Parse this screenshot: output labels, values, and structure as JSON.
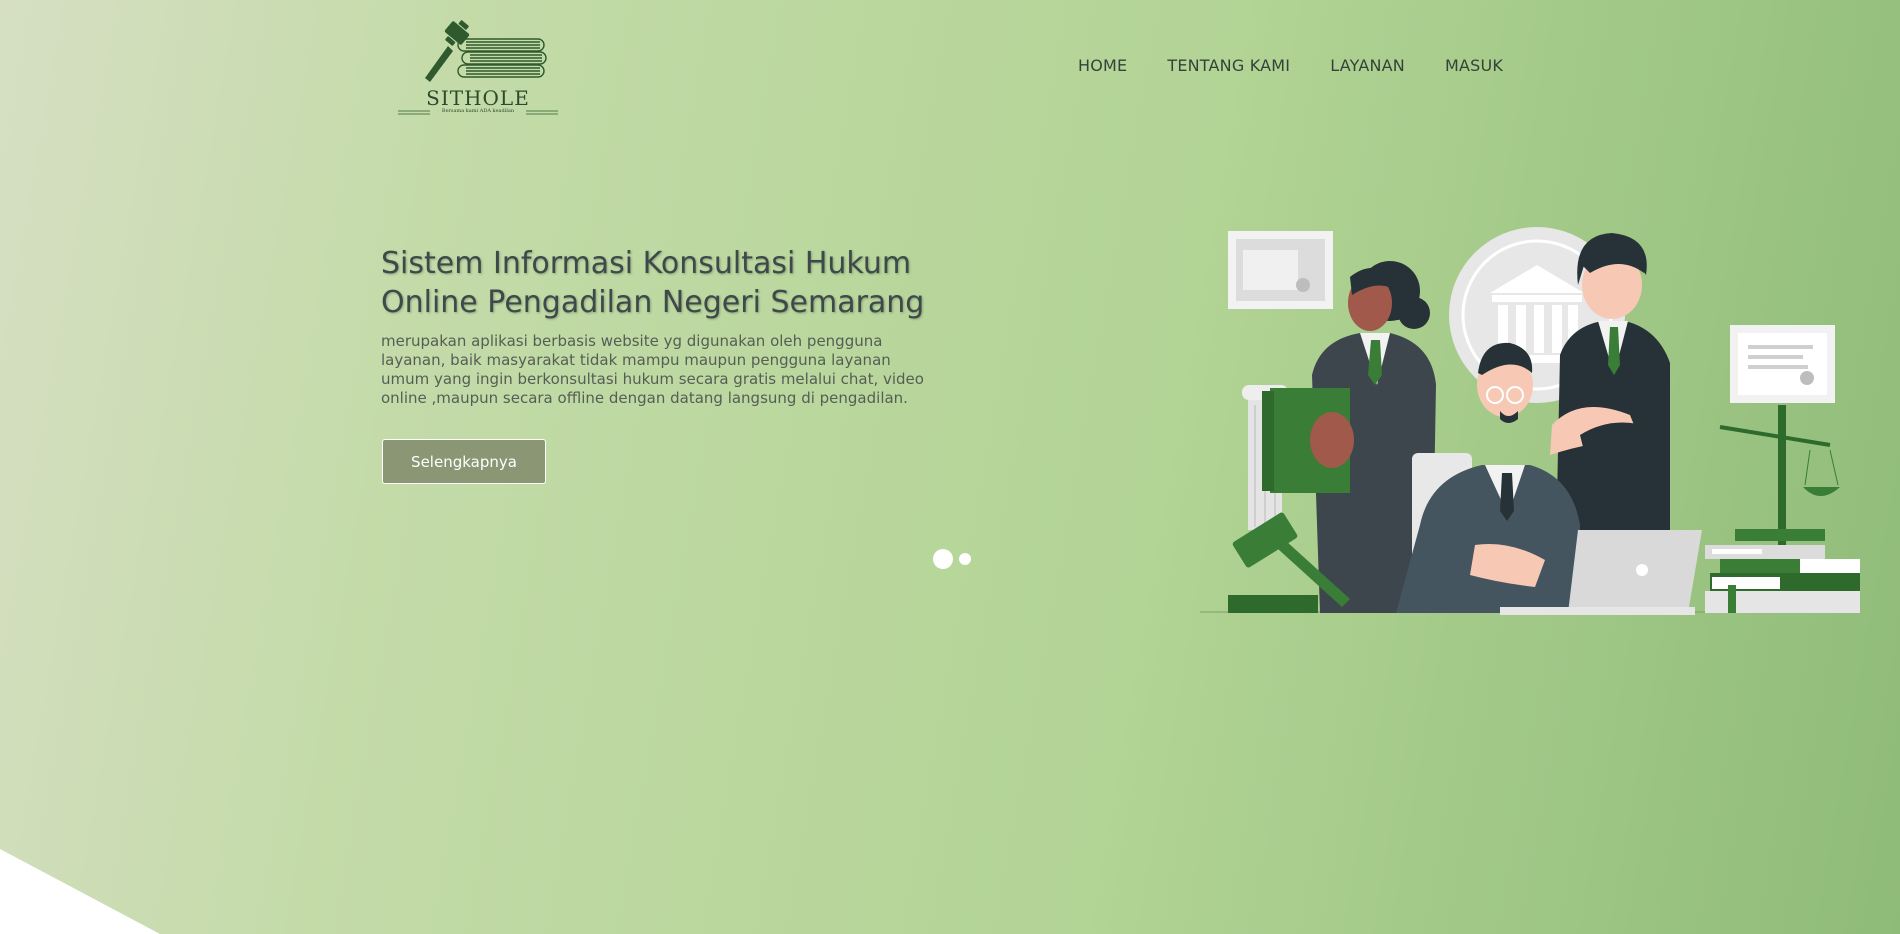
{
  "brand": {
    "name": "SITHOLE",
    "tagline": "Bersama kami ADA keadilan",
    "logo_color": "#2f5a2e"
  },
  "nav": {
    "items": [
      {
        "label": "HOME"
      },
      {
        "label": "TENTANG KAMI"
      },
      {
        "label": "LAYANAN"
      },
      {
        "label": "MASUK"
      }
    ]
  },
  "hero": {
    "title_line1": "Sistem Informasi Konsultasi Hukum",
    "title_line2": "Online Pengadilan Negeri Semarang",
    "description": "merupakan aplikasi berbasis website yg digunakan oleh pengguna layanan, baik masyarakat tidak mampu maupun pengguna layanan umum yang ingin berkonsultasi hukum secara gratis melalui chat, video online ,maupun secara offline dengan datang langsung di pengadilan.",
    "cta_label": "Selengkapnya"
  },
  "slider": {
    "slide_count": 2,
    "active_index": 0
  },
  "colors": {
    "gradient_start": "#d6dfc3",
    "gradient_end": "#8fbb78",
    "button_bg": "#8a9674",
    "dark_green": "#2f6b2d",
    "suit_dark": "#3d464c"
  },
  "illustration": {
    "icons": [
      "lawyers-illustration",
      "gavel-icon",
      "scales-icon",
      "courthouse-icon",
      "laptop-icon",
      "books-icon",
      "certificate-icon"
    ]
  }
}
